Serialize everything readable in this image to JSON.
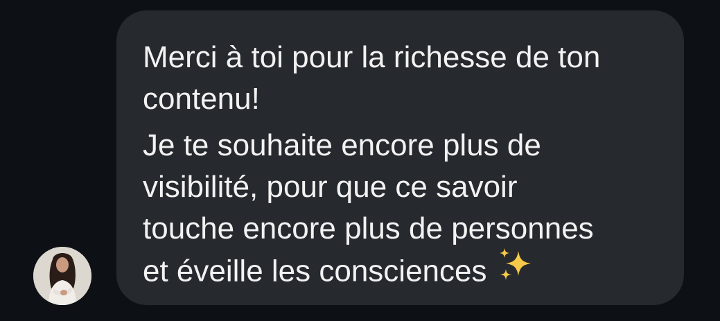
{
  "chat": {
    "message": {
      "paragraph1": [
        "Merci à toi pour la richesse de ton",
        "contenu!"
      ],
      "paragraph2": [
        "Je te souhaite encore plus de",
        "visibilité, pour que ce savoir",
        "touche encore plus de personnes",
        "et éveille les consciences"
      ],
      "emoji": "sparkles-icon"
    },
    "avatar": "user-avatar"
  },
  "colors": {
    "background": "#0d1015",
    "bubble": "#26292e",
    "text": "#f2f2f2",
    "sparkle": "#f7c948"
  }
}
